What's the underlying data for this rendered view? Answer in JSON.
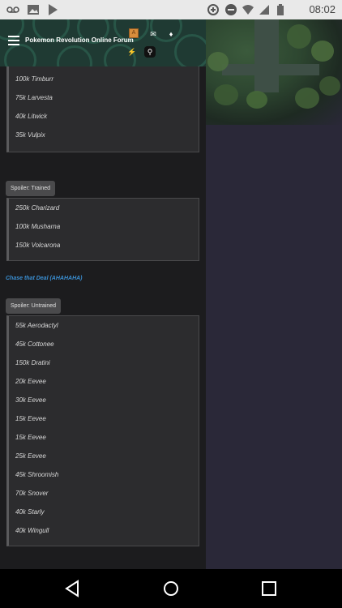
{
  "status_bar": {
    "time": "08:02",
    "icons_left": [
      "voicemail-icon",
      "image-icon",
      "play-store-icon"
    ],
    "icons_right": [
      "data-saver-icon",
      "do-not-disturb-icon",
      "wifi-icon",
      "signal-icon",
      "battery-icon"
    ]
  },
  "header": {
    "title": "Pokemon Revolution Online Forum",
    "avatar_letter": "A",
    "icons": [
      "mail-icon",
      "bell-icon",
      "lightning-icon",
      "search-icon"
    ]
  },
  "spoiler_first": {
    "items": [
      "100k Timburr",
      "75k Larvesta",
      "40k Litwick",
      "35k Vulpix"
    ]
  },
  "spoiler_trained": {
    "button": "Spoiler: Trained",
    "items": [
      "250k Charizard",
      "100k Musharna",
      "150k Volcarona"
    ]
  },
  "deal_link": "Chase that Deal (AHAHAHA)",
  "spoiler_untrained": {
    "button": "Spoiler: Untrained",
    "items": [
      "55k Aerodactyl",
      "45k Cottonee",
      "150k Dratini",
      "20k Eevee",
      "30k Eevee",
      "15k Eevee",
      "15k Eevee",
      "25k Eevee",
      "45k Shroomish",
      "70k Snover",
      "40k Starly",
      "40k Wingull"
    ]
  },
  "nav": {
    "back": "back-icon",
    "home": "home-icon",
    "recents": "recents-icon"
  },
  "colors": {
    "link": "#3a8fd3",
    "header_bg": "#1f3a33",
    "panel_bg": "#2c2c2e",
    "right_bg": "#2a2838"
  }
}
